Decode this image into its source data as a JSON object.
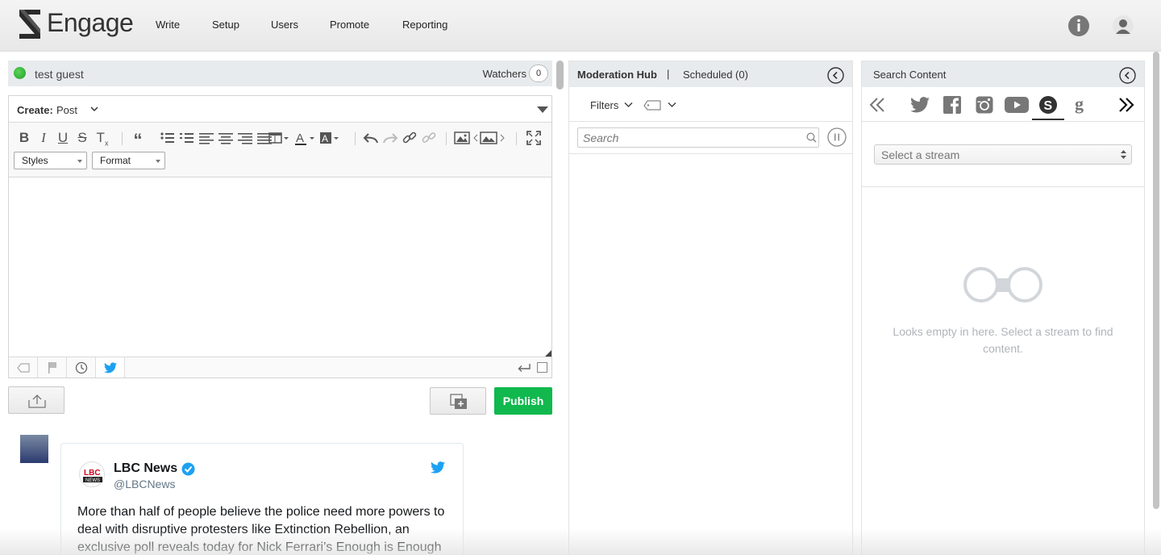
{
  "app": {
    "brand": "Engage"
  },
  "nav": {
    "items": [
      "Write",
      "Setup",
      "Users",
      "Promote",
      "Reporting"
    ]
  },
  "composer": {
    "guest_name": "test guest",
    "watchers_label": "Watchers",
    "watchers_count": "0",
    "create_label": "Create:",
    "create_type": "Post",
    "styles_label": "Styles",
    "format_label": "Format",
    "publish_label": "Publish"
  },
  "feed": {
    "tweet": {
      "name": "LBC News",
      "handle": "@LBCNews",
      "text": "More than half of people believe the police need more powers to deal with disruptive protesters like Extinction Rebellion, an exclusive poll reveals today for Nick Ferrari’s Enough is Enough"
    }
  },
  "moderation": {
    "tab_hub": "Moderation Hub",
    "tab_separator": "|",
    "tab_scheduled": "Scheduled (0)",
    "filters_label": "Filters",
    "search_placeholder": "Search"
  },
  "search_content": {
    "title": "Search Content",
    "stream_placeholder": "Select a stream",
    "empty_message": "Looks empty in here. Select a stream to find content.",
    "networks": [
      "twitter-icon",
      "facebook-icon",
      "instagram-icon",
      "youtube-icon",
      "scribble-icon",
      "google-icon"
    ],
    "active_network": "scribble-icon"
  },
  "colors": {
    "publish": "#10b84e",
    "status_online": "#2fb43a",
    "twitter": "#1da1f2"
  }
}
